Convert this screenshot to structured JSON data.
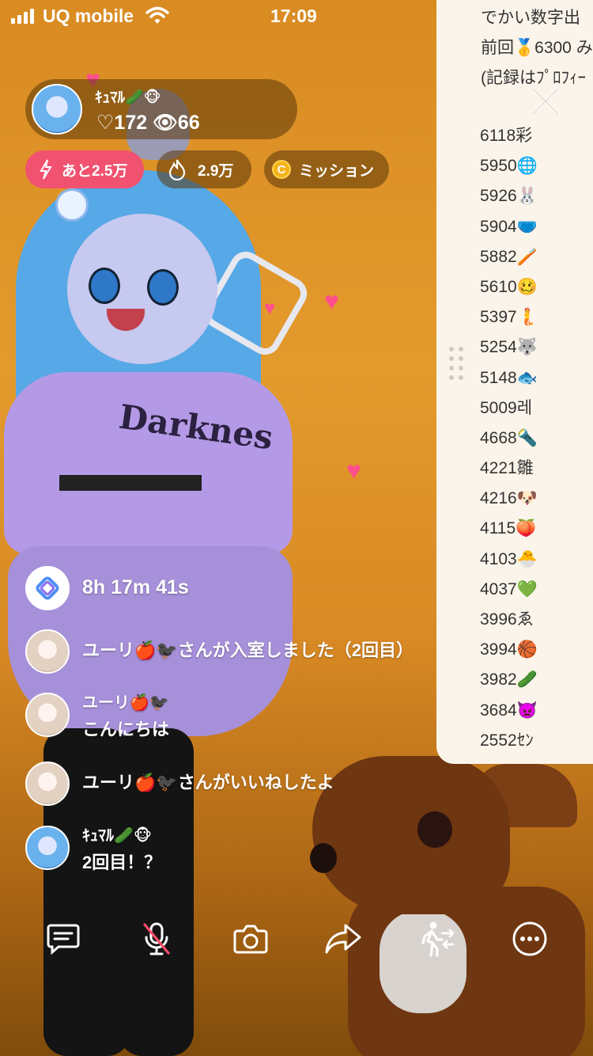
{
  "status_bar": {
    "carrier": "UQ mobile",
    "time": "17:09"
  },
  "streamer": {
    "name": "ｷｭﾏﾙ🥒🐵",
    "stats": "♡172 👁66"
  },
  "badges": {
    "goal": "あと2.5万",
    "points": "2.9万",
    "mission": "ミッション",
    "mission_coin": "C"
  },
  "ranking": {
    "header_lines": [
      "でかい数字出",
      "前回🥇6300 み",
      "(記録はﾌﾟﾛﾌｨｰ"
    ],
    "entries": [
      "6118彩",
      "5950🌐",
      "5926🐰",
      "5904🩲",
      "5882🪥",
      "5610🥴",
      "5397🧜",
      "5254🐺",
      "5148🐟",
      "5009레",
      "4668🔦",
      "4221雛",
      "4216🐶",
      "4115🍑",
      "4103🐣",
      "4037💚",
      "3996ゑ",
      "3994🏀",
      "3982🥒",
      "3684👿",
      "2552ｾﾝ"
    ]
  },
  "chat": [
    {
      "text": "8h 17m 41s"
    },
    {
      "text": "ユーリ🍎🐦‍⬛さんが入室しました（2回目）"
    },
    {
      "name": "ユーリ🍎🐦‍⬛",
      "text": "こんにちは"
    },
    {
      "text": "ユーリ🍎🐦‍⬛さんがいいねしたよ"
    },
    {
      "name": "ｷｭﾏﾙ🥒🐵",
      "text": "2回目！？"
    }
  ],
  "toolbar_icons": [
    "comment-icon",
    "mic-muted-icon",
    "camera-icon",
    "share-icon",
    "swap-user-icon",
    "more-icon"
  ],
  "colors": {
    "background": "#e39a2c",
    "goal_pill": "#f1526f",
    "coin": "#f5b21a",
    "panel": "#fbf4ea"
  }
}
